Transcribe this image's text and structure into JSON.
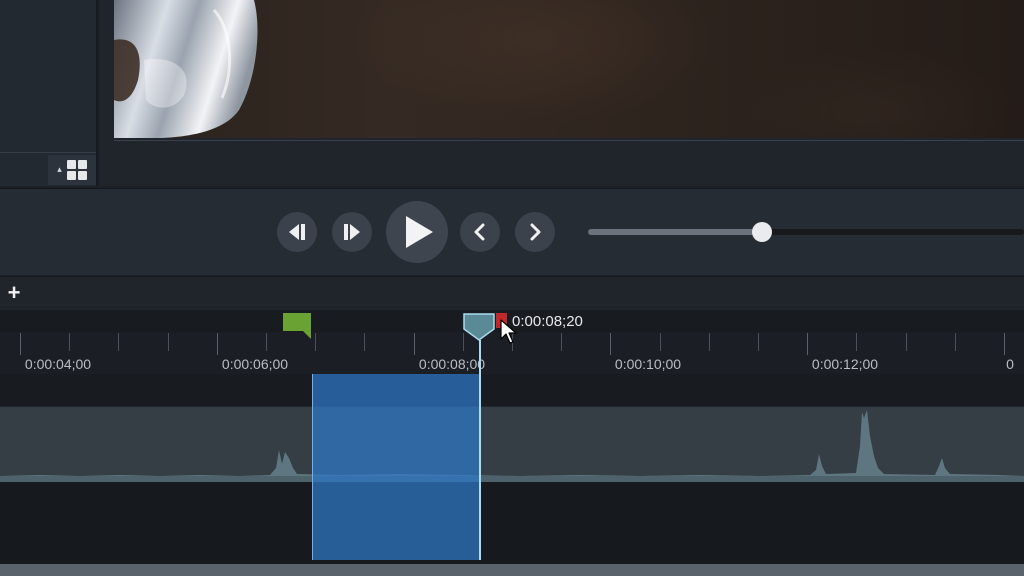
{
  "preview": {
    "layout_toggle_icon": "grid-layout-icon",
    "layout_caret_icon": "caret-up-icon"
  },
  "controls": {
    "step_back_icon": "step-backward-icon",
    "step_forward_icon": "step-forward-icon",
    "play_icon": "play-icon",
    "previous_icon": "chevron-left-icon",
    "next_icon": "chevron-right-icon",
    "scrub_position": 0.4
  },
  "timeline": {
    "add_track_label": "+",
    "playhead_time": "0:00:08;20",
    "ruler_labels": [
      "0:00:04;00",
      "0:00:06;00",
      "0:00:08;00",
      "0:00:10;00",
      "0:00:12;00",
      "0"
    ],
    "marker_colors": {
      "start_marker": "#6aa233",
      "end_marker": "#c0282b",
      "playhead": "#5a8a96"
    },
    "selection_color": "#2e78c8",
    "accent_colors": {
      "waveform": "#5d7680",
      "track": "#353d45"
    }
  }
}
